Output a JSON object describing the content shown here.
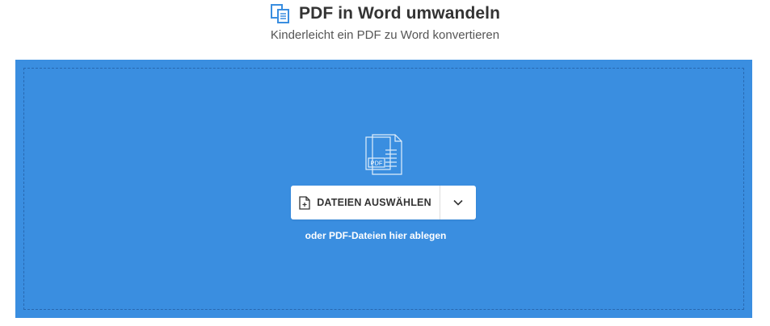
{
  "header": {
    "title": "PDF in Word umwandeln",
    "subtitle": "Kinderleicht ein PDF zu Word konvertieren",
    "icon": "pdf-to-word-icon"
  },
  "dropzone": {
    "background_color": "#3a8ee0",
    "illustration_label": "PDF",
    "choose_files_label": "DATEIEN AUSWÄHLEN",
    "choose_files_icon": "file-add-icon",
    "dropdown_icon": "chevron-down-icon",
    "drop_hint": "oder PDF-Dateien hier ablegen"
  },
  "colors": {
    "accent": "#3a8ee0",
    "title_text": "#333333",
    "subtitle_text": "#555555"
  }
}
